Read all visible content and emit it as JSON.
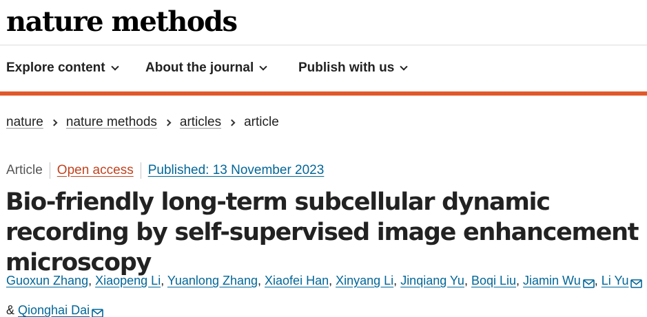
{
  "brand": {
    "name": "nature methods"
  },
  "nav": {
    "items": [
      {
        "label": "Explore content"
      },
      {
        "label": "About the journal"
      },
      {
        "label": "Publish with us"
      }
    ]
  },
  "colors": {
    "accent": "#e0592b",
    "link": "#006699",
    "open_access": "#c2421e"
  },
  "breadcrumb": [
    "nature",
    "nature methods",
    "articles",
    "article"
  ],
  "article": {
    "type": "Article",
    "access": "Open access",
    "published": "Published: 13 November 2023",
    "title": "Bio-friendly long-term subcellular dynamic recording by self-supervised image enhancement microscopy",
    "authors": [
      "Guoxun Zhang",
      "Xiaopeng Li",
      "Yuanlong Zhang",
      "Xiaofei Han",
      "Xinyang Li",
      "Jinqiang Yu",
      "Boqi Liu",
      "Jiamin Wu",
      "Li Yu",
      "Qionghai Dai"
    ],
    "separators": {
      "comma": ",",
      "and": "&"
    },
    "icons": {
      "email": "envelope-icon"
    }
  }
}
